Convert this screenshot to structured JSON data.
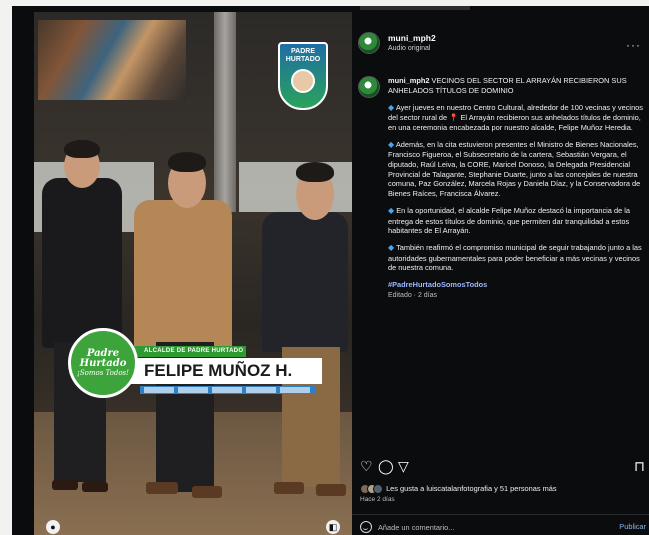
{
  "post": {
    "username": "muni_mph2",
    "audio_label": "Audio original",
    "caption": {
      "title": "VECINOS DEL SECTOR EL ARRAYÁN RECIBIERON SUS ANHELADOS TÍTULOS DE DOMINIO",
      "p1_a": "Ayer jueves en nuestro Centro Cultural, alrededor de 100 vecinas y vecinos del sector rural de",
      "p1_b": "El Arrayán recibieron sus anhelados títulos de dominio, en una ceremonia encabezada por nuestro alcalde, Felipe Muñoz Heredia.",
      "p2": "Además, en la cita estuvieron presentes el Ministro de Bienes Nacionales, Francisco Figueroa, el Subsecretario de la cartera, Sebastián Vergara, el diputado, Raúl Leiva, la CORE, Maricel Donoso, la Delegada Presidencial Provincial de Talagante, Stephanie Duarte, junto a las concejales de nuestra comuna, Paz González, Marcela Rojas y Daniela Díaz, y la Conservadora de Bienes Raíces, Francisca Álvarez.",
      "p3": "En la oportunidad, el alcalde Felipe Muñoz destacó la importancia de la entrega de estos títulos de dominio, que permiten dar tranquilidad a estos habitantes de El Arrayán.",
      "p4": "También reafirmó el compromiso municipal de seguir trabajando junto a las autoridades gubernamentales para poder beneficiar a más vecinas y vecinos de nuestra comuna.",
      "hashtag": "#PadreHurtadoSomosTodos",
      "edited": "Editado · 2 días"
    },
    "likes_text": "Les gusta a luiscatalanfotografia y 51 personas más",
    "likes_user": "luiscatalanfotografia",
    "ago": "Hace 2 días",
    "comment_placeholder": "Añade un comentario...",
    "publish_label": "Publicar"
  },
  "media": {
    "badge_title": "PADRE",
    "badge_sub": "HURTADO",
    "lower_third": {
      "circle_line1": "Padre",
      "circle_line2": "Hurtado",
      "circle_line3": "¡Somos Todos!",
      "role": "ALCALDE DE PADRE HURTADO",
      "name": "FELIPE MUÑOZ H."
    }
  },
  "icons": {
    "heart": "heart-icon",
    "comment": "comment-icon",
    "share": "share-icon",
    "save": "bookmark-icon",
    "more": "more-options-icon",
    "emoji": "emoji-icon"
  },
  "colors": {
    "accent_green": "#3da33b",
    "link_blue": "#4aa3f0",
    "background": "#0b0c0e"
  }
}
